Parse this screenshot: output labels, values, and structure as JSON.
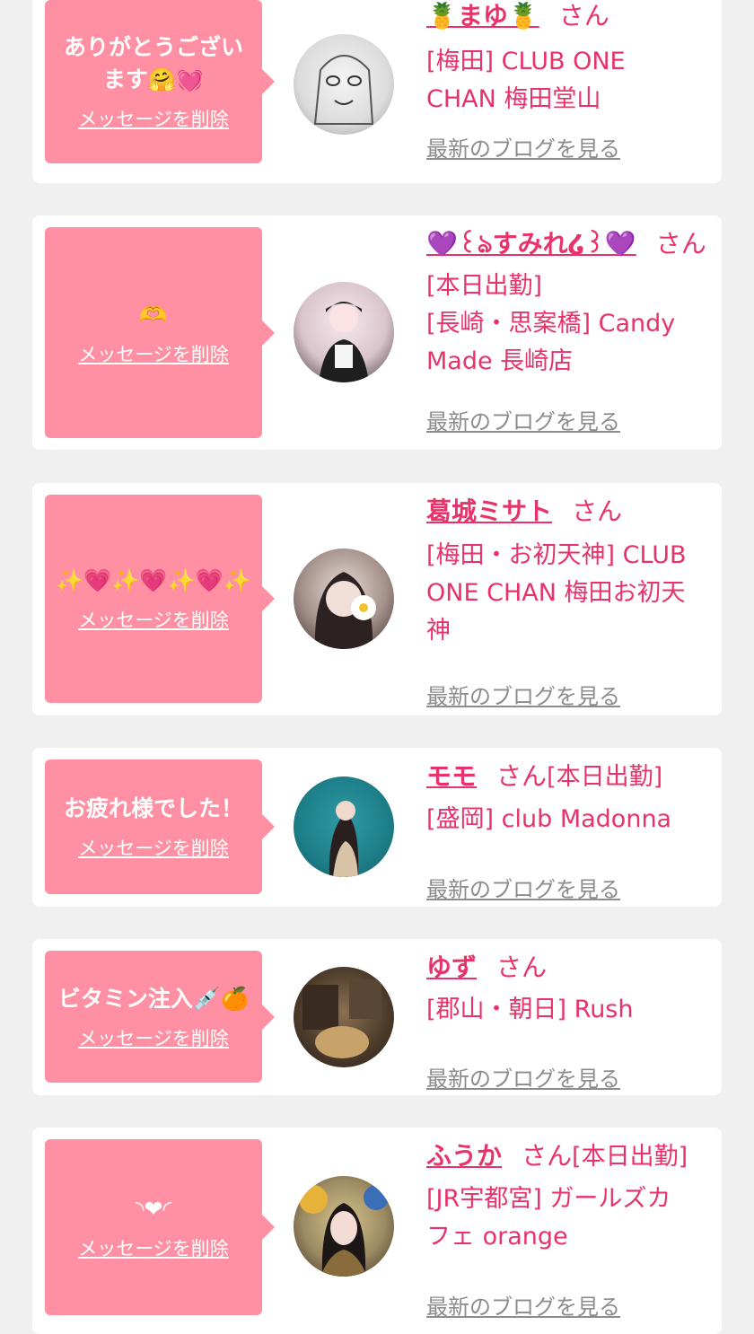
{
  "delete_label": "メッセージを削除",
  "blog_label": "最新のブログを見る",
  "san_label": "さん",
  "messages": [
    {
      "message": "ありがとうございます🤗💓",
      "name": "🍍まゆ🍍",
      "shop_lines": [
        "[梅田] CLUB ONE",
        "CHAN 梅田堂山"
      ]
    },
    {
      "message": "🫶",
      "name": "💜꒰ঌすみれ໒꒱💜",
      "shop_lines": [
        "[本日出勤]",
        "[長崎・思案橋] Candy",
        "Made 長崎店"
      ]
    },
    {
      "message": "✨💗✨💗✨💗✨",
      "name": "葛城ミサト",
      "shop_lines": [
        "[梅田・お初天神] CLUB",
        "ONE CHAN 梅田お初天",
        "神"
      ]
    },
    {
      "message": "お疲れ様でした！",
      "name": "モモ",
      "inline_tag": "[本日出勤]",
      "shop_lines": [
        "[盛岡] club Madonna"
      ]
    },
    {
      "message": "ビタミン注入💉🍊",
      "name": "ゆず",
      "shop_lines": [
        "[郡山・朝日] Rush"
      ]
    },
    {
      "message": "◝❤◜",
      "name": "ふうか",
      "inline_tag": "[本日出勤]",
      "shop_lines": [
        "[JR宇都宮] ガールズカ",
        "フェ orange"
      ]
    }
  ],
  "colors": {
    "page_bg": "#f0f0f0",
    "bubble_bg": "#ff8fa3",
    "accent": "#e8336a",
    "link_gray": "#8c8c8c"
  }
}
